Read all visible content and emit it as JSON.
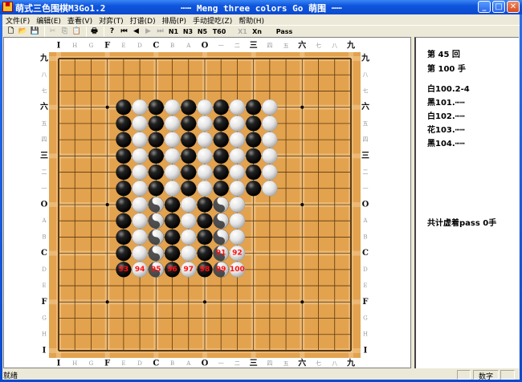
{
  "window": {
    "title_left": "萌式三色围棋M3Go1.2",
    "title_center": "┅┅ Meng three colors Go 萌围 ┅┅",
    "minimize": "_",
    "maximize": "□",
    "close": "✕"
  },
  "menu": [
    "文件(F)",
    "编辑(E)",
    "查看(V)",
    "对弈(T)",
    "打谱(D)",
    "排局(P)",
    "手动提吃(Z)",
    "帮助(H)"
  ],
  "toolbar": {
    "items": [
      {
        "icon": "new-file-icon",
        "label": "🗋",
        "enabled": true
      },
      {
        "icon": "open-folder-icon",
        "label": "📂",
        "enabled": true
      },
      {
        "icon": "save-icon",
        "label": "💾",
        "enabled": true
      },
      {
        "sep": true
      },
      {
        "icon": "cut-icon",
        "label": "✂",
        "enabled": false
      },
      {
        "icon": "copy-icon",
        "label": "⎘",
        "enabled": false
      },
      {
        "icon": "paste-icon",
        "label": "📋",
        "enabled": false
      },
      {
        "sep": true
      },
      {
        "icon": "print-icon",
        "label": "🖶",
        "enabled": true
      },
      {
        "sep": true
      },
      {
        "icon": "help-icon",
        "label": "?",
        "enabled": true
      },
      {
        "icon": "first-move-icon",
        "label": "⏮",
        "enabled": true
      },
      {
        "icon": "previous-move-icon",
        "label": "◀",
        "enabled": true
      },
      {
        "icon": "next-move-icon",
        "label": "▶",
        "enabled": false
      },
      {
        "icon": "last-move-icon",
        "label": "⏭",
        "enabled": false
      },
      {
        "icon": "n1-icon",
        "label": "N1",
        "enabled": true
      },
      {
        "icon": "n3-icon",
        "label": "N3",
        "enabled": true
      },
      {
        "icon": "n5-icon",
        "label": "N5",
        "enabled": true
      },
      {
        "icon": "t60-icon",
        "label": "T60",
        "enabled": true
      },
      {
        "icon": "x1-icon",
        "label": "X1",
        "enabled": false
      },
      {
        "icon": "xn-icon",
        "label": "Xn",
        "enabled": true
      },
      {
        "icon": "pass-icon",
        "label": "Pass",
        "enabled": true
      }
    ]
  },
  "board": {
    "columns": [
      "I",
      "H",
      "G",
      "F",
      "E",
      "D",
      "C",
      "B",
      "A",
      "O",
      "一",
      "二",
      "三",
      "四",
      "五",
      "六",
      "七",
      "八",
      "九"
    ],
    "rows": [
      "九",
      "八",
      "七",
      "六",
      "五",
      "四",
      "三",
      "二",
      "一",
      "O",
      "A",
      "B",
      "C",
      "D",
      "E",
      "F",
      "G",
      "H",
      "I"
    ],
    "major_labels": [
      "I",
      "F",
      "C",
      "O",
      "三",
      "六",
      "九"
    ],
    "star_points": [
      [
        "F",
        "六"
      ],
      [
        "O",
        "六"
      ],
      [
        "六",
        "六"
      ],
      [
        "F",
        "O"
      ],
      [
        "O",
        "O"
      ],
      [
        "六",
        "O"
      ],
      [
        "F",
        "F"
      ],
      [
        "O",
        "F"
      ],
      [
        "六",
        "F"
      ]
    ],
    "grid": [
      "...................",
      "...................",
      "...................",
      "....BWBWBWBWBW.....",
      "....BWBWBWBWBW.....",
      "....BWBWBWBWBW.....",
      "....BWBWBWBWBW.....",
      "....BWBWBWBWBW.....",
      "....BWBWBWBWBW.....",
      "....BWHBWBHW.......",
      "....BWHBWBHW.......",
      "....BWHBWBHW.......",
      "....BWHBWBHW.......",
      "....BWHBWBHW.......",
      "...................",
      "...................",
      "...................",
      "...................",
      "..................."
    ],
    "stone_legend": {
      "B": "black",
      "W": "white",
      "H": "花 (three-color)"
    },
    "move_numbers": [
      {
        "col": "一",
        "row": "C",
        "n": "91"
      },
      {
        "col": "二",
        "row": "C",
        "n": "92"
      },
      {
        "col": "E",
        "row": "D",
        "n": "93"
      },
      {
        "col": "D",
        "row": "D",
        "n": "94"
      },
      {
        "col": "C",
        "row": "D",
        "n": "95"
      },
      {
        "col": "B",
        "row": "D",
        "n": "96"
      },
      {
        "col": "A",
        "row": "D",
        "n": "97"
      },
      {
        "col": "O",
        "row": "D",
        "n": "98"
      },
      {
        "col": "一",
        "row": "D",
        "n": "99"
      },
      {
        "col": "二",
        "row": "D",
        "n": "100"
      }
    ],
    "colors": {
      "wood": "#e3a24e",
      "line": "#5a3a10",
      "band": "#f0c890",
      "number": "#ff1010"
    }
  },
  "info": {
    "round": "第 45 回",
    "move": "第 100 手",
    "records": [
      "白100.2-4",
      "黑101.┅┅",
      "白102.┅┅",
      "花103.┅┅",
      "黑104.┅┅"
    ],
    "pass_total": "共计虚着pass 0手"
  },
  "status": {
    "text": "就绪",
    "num_indicator": "数字"
  }
}
